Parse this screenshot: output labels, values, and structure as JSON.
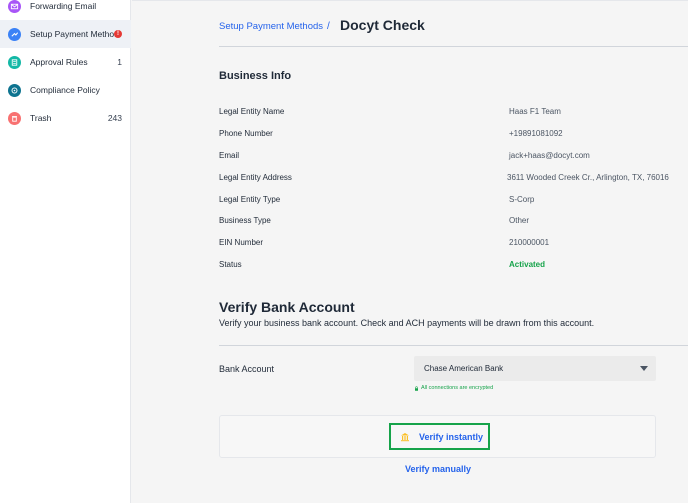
{
  "sidebar": {
    "items": [
      {
        "label": "Forwarding Email",
        "count": "",
        "icon": "mail-icon",
        "color": "#a855f7"
      },
      {
        "label": "Setup Payment Metho...",
        "count": "",
        "badge": "!",
        "icon": "payment-icon",
        "color": "#3b82f6"
      },
      {
        "label": "Approval Rules",
        "count": "1",
        "icon": "rules-icon",
        "color": "#14b8a6"
      },
      {
        "label": "Compliance Policy",
        "count": "",
        "icon": "compliance-icon",
        "color": "#0e7490"
      },
      {
        "label": "Trash",
        "count": "243",
        "icon": "trash-icon",
        "color": "#f87171"
      }
    ]
  },
  "header": {
    "breadcrumb_link": "Setup Payment Methods",
    "separator": "/",
    "title": "Docyt Check"
  },
  "business_info": {
    "title": "Business Info",
    "rows": [
      {
        "label": "Legal Entity Name",
        "value": "Haas F1 Team"
      },
      {
        "label": "Phone Number",
        "value": "+19891081092"
      },
      {
        "label": "Email",
        "value": "jack+haas@docyt.com"
      },
      {
        "label": "Legal Entity Address",
        "value": "3611 Wooded Creek Cr., Arlington, TX, 76016"
      },
      {
        "label": "Legal Entity Type",
        "value": "S-Corp"
      },
      {
        "label": "Business Type",
        "value": "Other"
      },
      {
        "label": "EIN Number",
        "value": "210000001"
      },
      {
        "label": "Status",
        "value": "Activated"
      }
    ]
  },
  "verify": {
    "title": "Verify Bank Account",
    "description": "Verify your business bank account. Check and ACH payments will be drawn from this account.",
    "bank_label": "Bank Account",
    "bank_selected": "Chase American Bank",
    "encrypted_note": "All connections are encrypted",
    "verify_instantly": "Verify instantly",
    "verify_manually": "Verify manually"
  },
  "colors": {
    "link": "#2563eb",
    "success": "#16a34a",
    "badge": "#e53935"
  }
}
